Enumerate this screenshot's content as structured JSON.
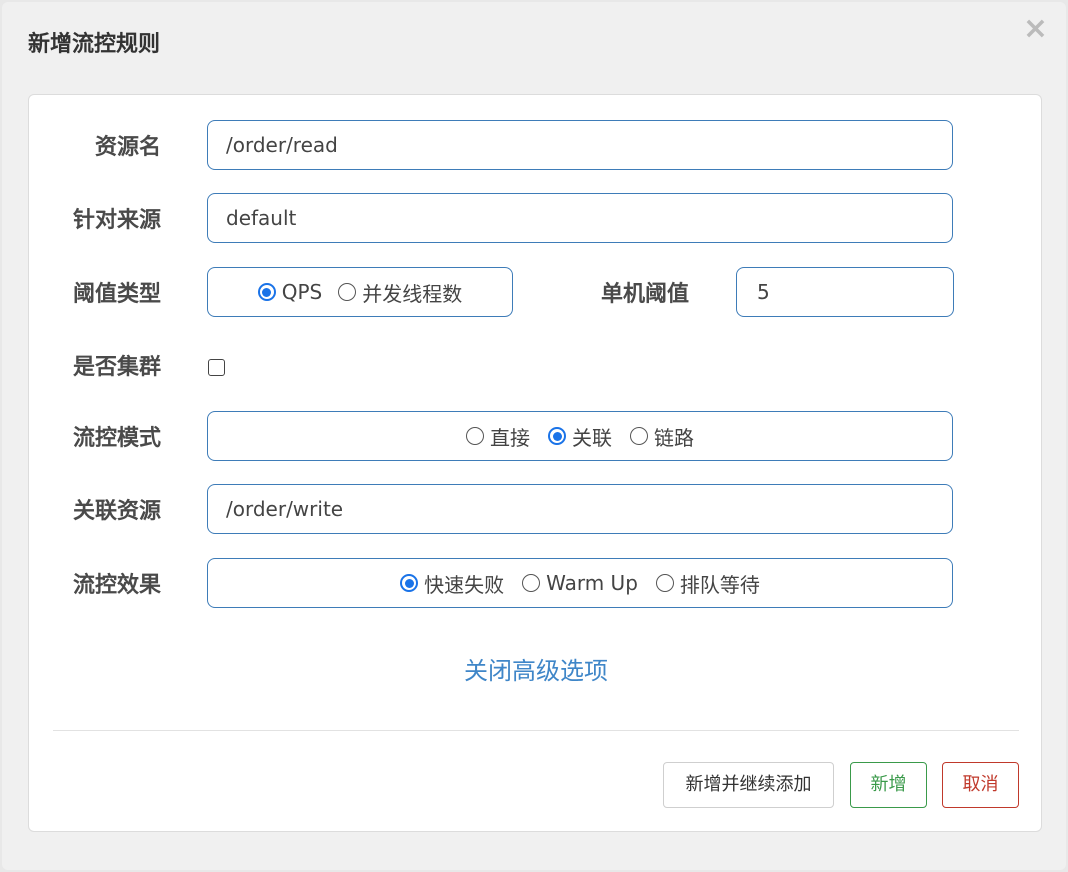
{
  "dialog": {
    "title": "新增流控规则",
    "close_glyph": "×"
  },
  "form": {
    "resource": {
      "label": "资源名",
      "value": "/order/read"
    },
    "origin": {
      "label": "针对来源",
      "value": "default"
    },
    "threshold_type": {
      "label": "阈值类型",
      "options": [
        {
          "label": "QPS",
          "checked": true
        },
        {
          "label": "并发线程数",
          "checked": false
        }
      ]
    },
    "threshold": {
      "label": "单机阈值",
      "value": "5"
    },
    "cluster": {
      "label": "是否集群",
      "checked": false
    },
    "strategy": {
      "label": "流控模式",
      "options": [
        {
          "label": "直接",
          "checked": false
        },
        {
          "label": "关联",
          "checked": true
        },
        {
          "label": "链路",
          "checked": false
        }
      ]
    },
    "ref_resource": {
      "label": "关联资源",
      "value": "/order/write"
    },
    "control_behavior": {
      "label": "流控效果",
      "options": [
        {
          "label": "快速失败",
          "checked": true
        },
        {
          "label": "Warm Up",
          "checked": false
        },
        {
          "label": "排队等待",
          "checked": false
        }
      ]
    },
    "advanced_toggle": "关闭高级选项"
  },
  "footer": {
    "add_continue": "新增并继续添加",
    "add": "新增",
    "cancel": "取消"
  },
  "colors": {
    "accent": "#3e7cb8",
    "radio_checked": "#1a73e8",
    "link": "#3f86c8",
    "success": "#3a9a4a",
    "danger": "#c0392b"
  }
}
